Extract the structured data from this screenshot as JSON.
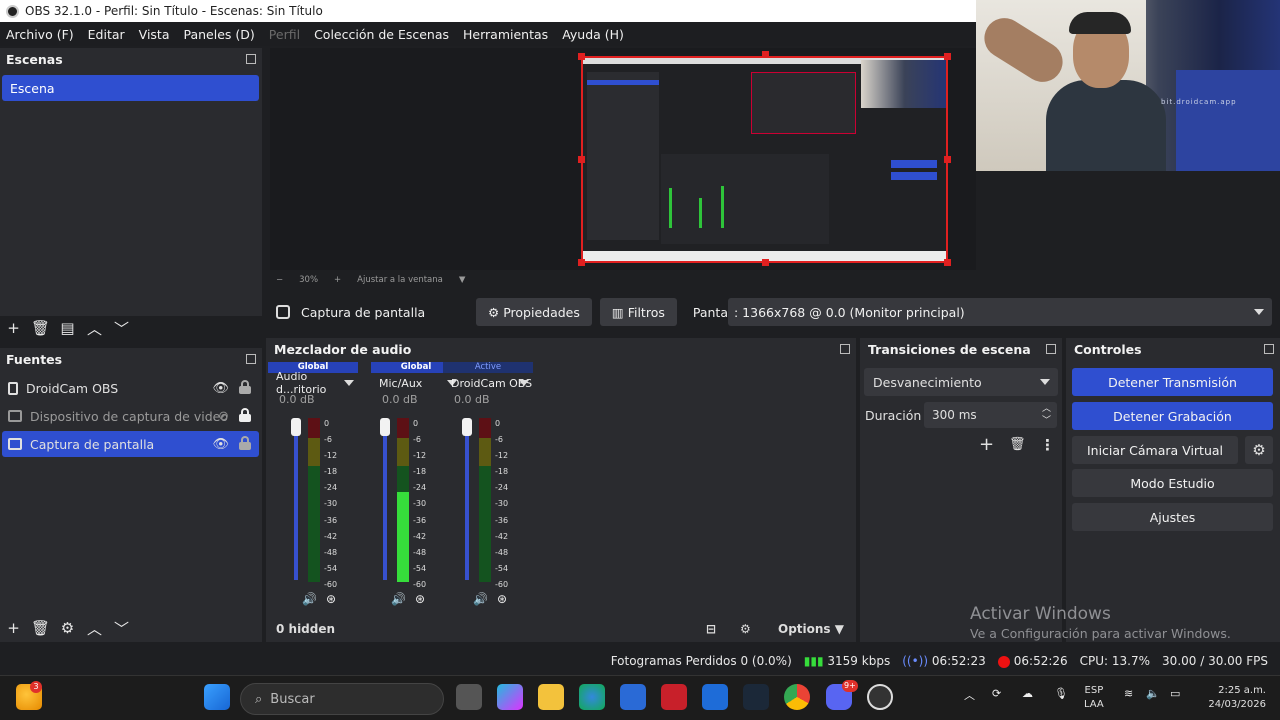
{
  "window": {
    "title": "OBS 32.1.0 - Perfil: Sin Título - Escenas: Sin Título"
  },
  "menu": [
    "Archivo (F)",
    "Editar",
    "Vista",
    "Paneles (D)",
    "Perfil",
    "Colección de Escenas",
    "Herramientas",
    "Ayuda (H)"
  ],
  "camera": {
    "watermark": "bit.droidcam.app"
  },
  "scenes": {
    "title": "Escenas",
    "items": [
      "Escena"
    ]
  },
  "preview": {
    "zoom": "30%",
    "fit_label": "Ajustar a la ventana"
  },
  "source_bar": {
    "name": "Captura de pantalla",
    "properties": "Propiedades",
    "filters": "Filtros",
    "screen_label": "Pantalla",
    "monitor": ": 1366x768 @ 0.0 (Monitor principal)"
  },
  "sources": {
    "title": "Fuentes",
    "items": [
      {
        "name": "DroidCam OBS",
        "visible": true
      },
      {
        "name": "Dispositivo de captura de video",
        "visible": false
      },
      {
        "name": "Captura de pantalla",
        "visible": true,
        "selected": true
      }
    ]
  },
  "mixer": {
    "title": "Mezclador de audio",
    "scale": [
      "0",
      "-6",
      "-12",
      "-18",
      "-24",
      "-30",
      "-36",
      "-42",
      "-48",
      "-54",
      "-60"
    ],
    "channels": [
      {
        "tag": "Global",
        "name": "Audio d...ritorio",
        "db": "0.0 dB",
        "level": 0
      },
      {
        "tag": "Global",
        "name": "Mic/Aux",
        "db": "0.0 dB",
        "level": 0.55
      },
      {
        "tag": "Active",
        "name": "DroidCam OBS",
        "db": "0.0 dB",
        "level": 0
      }
    ],
    "hidden": "0 hidden",
    "options": "Options"
  },
  "transitions": {
    "title": "Transiciones de escena",
    "selected": "Desvanecimiento",
    "duration_label": "Duración",
    "duration": "300 ms"
  },
  "controls": {
    "title": "Controles",
    "buttons": [
      "Detener Transmisión",
      "Detener Grabación",
      "Iniciar Cámara Virtual",
      "Modo Estudio",
      "Ajustes"
    ]
  },
  "activation": {
    "line1": "Activar Windows",
    "line2": "Ve a Configuración para activar Windows."
  },
  "status": {
    "dropped": "Fotogramas Perdidos 0 (0.0%)",
    "bitrate": "3159 kbps",
    "stream_time": "06:52:23",
    "rec_time": "06:52:26",
    "cpu": "CPU: 13.7%",
    "fps": "30.00 / 30.00 FPS"
  },
  "taskbar": {
    "search": "Buscar",
    "lang1": "ESP",
    "lang2": "LAA",
    "time": "2:25 a.m.",
    "date": "24/03/2026",
    "weather_badge": "3",
    "discord_badge": "9+"
  }
}
